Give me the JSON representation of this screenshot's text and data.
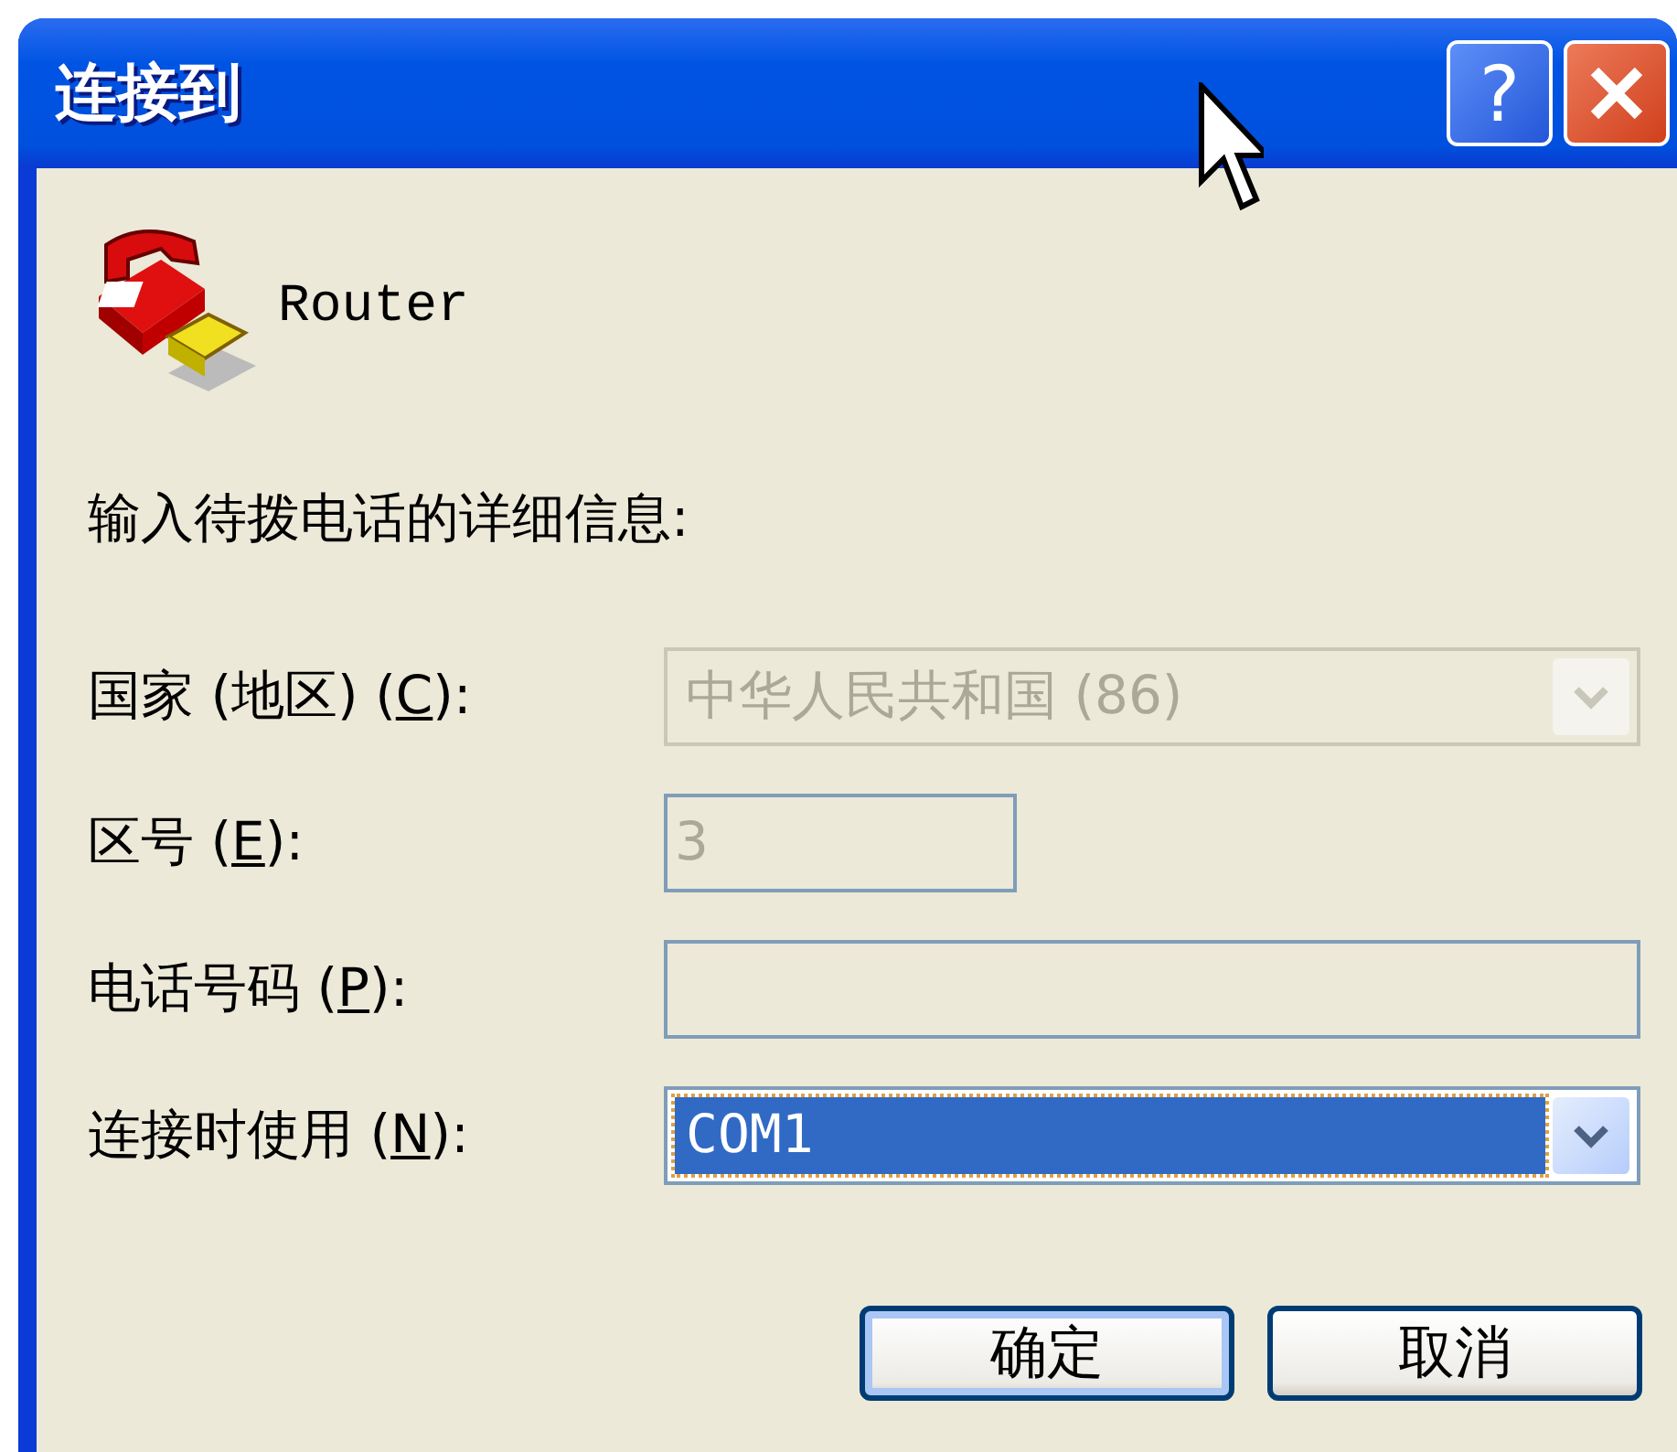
{
  "window": {
    "title": "连接到",
    "help_button": "?"
  },
  "entry": {
    "name": "Router"
  },
  "instruction": "输入待拨电话的详细信息:",
  "fields": [
    {
      "kind": "dropdown",
      "label": "国家 (地区) (C):",
      "value": "中华人民共和国 (86)",
      "disabled": true,
      "focused": false
    },
    {
      "kind": "text",
      "label": "区号 (E):",
      "value": "3",
      "disabled": true,
      "focused": false
    },
    {
      "kind": "text",
      "label": "电话号码 (P):",
      "disabled": true,
      "focused": false
    },
    {
      "kind": "dropdown",
      "label": "连接时使用 (N):",
      "value": "COM1",
      "disabled": false,
      "focused": true
    }
  ],
  "buttons": [
    {
      "label": "确定",
      "default": true
    },
    {
      "label": "取消",
      "default": false
    }
  ]
}
